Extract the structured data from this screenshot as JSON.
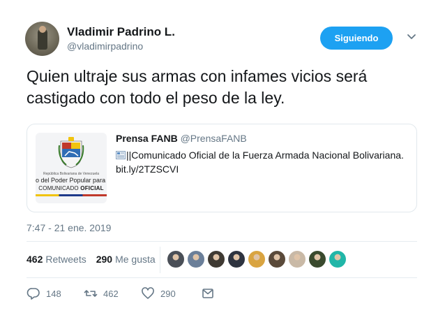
{
  "author": {
    "name": "Vladimir Padrino L.",
    "handle": "@vladimirpadrino"
  },
  "follow_button": "Siguiendo",
  "tweet": {
    "text": "Quien ultraje sus armas con infames vicios será castigado con todo el peso de la ley."
  },
  "quoted": {
    "author_name": "Prensa FANB",
    "author_handle": "@PrensaFANB",
    "text_suffix": "||Comunicado Oficial de la Fuerza Armada Nacional Bolivariana.",
    "link": "bit.ly/2TZSCVI",
    "thumb": {
      "line1": "República Bolivariana de Venezuela",
      "line2": "o del Poder Popular para la",
      "comunicado": "COMUNICADO",
      "oficial": "OFICIAL"
    }
  },
  "timestamp": "7:47 - 21 ene. 2019",
  "stats": {
    "retweets_count": "462",
    "retweets_label": "Retweets",
    "likes_count": "290",
    "likes_label": "Me gusta"
  },
  "likers": [
    {
      "color": "#4a4f57"
    },
    {
      "color": "#6b7f99"
    },
    {
      "color": "#3f3a33"
    },
    {
      "color": "#2e3440"
    },
    {
      "color": "#d9a441"
    },
    {
      "color": "#5a4a3a"
    },
    {
      "color": "#c9b9a6"
    },
    {
      "color": "#3a4a2e"
    },
    {
      "color": "#21b6a8"
    }
  ],
  "actions": {
    "replies": "148",
    "retweets": "462",
    "likes": "290"
  },
  "colors": {
    "accent": "#1da1f2",
    "muted": "#657786"
  }
}
